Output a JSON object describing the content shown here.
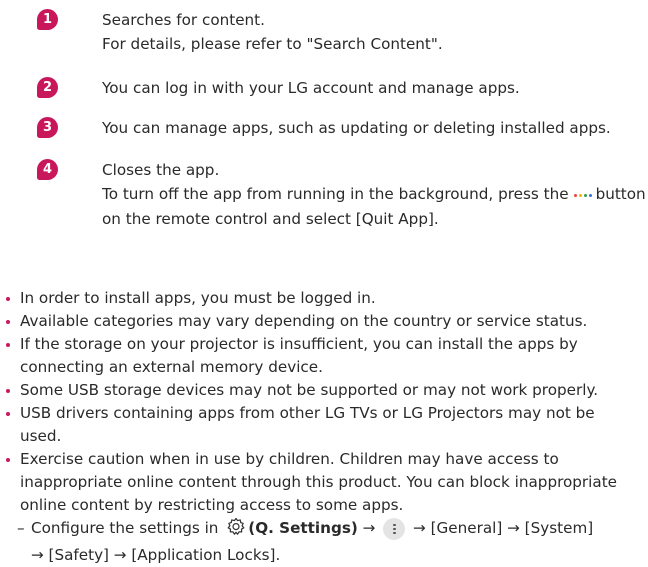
{
  "steps": [
    {
      "number": "1",
      "lines": [
        "Searches for content.",
        "For details, please refer to \"Search Content\"."
      ]
    },
    {
      "number": "2",
      "lines": [
        "You can log in with your LG account and manage apps."
      ]
    },
    {
      "number": "3",
      "lines": [
        "You can manage apps, such as updating or deleting installed apps."
      ]
    },
    {
      "number": "4",
      "line1": "Closes the app.",
      "line2_before": "To turn off the app from running in the background, press the",
      "line2_after": "button",
      "line3": "on the remote control and select [Quit App]."
    }
  ],
  "bullets": [
    [
      "In order to install apps, you must be logged in."
    ],
    [
      "Available categories may vary depending on the country or service status."
    ],
    [
      "If the storage on your projector is insufficient, you can install the apps by",
      "connecting an external memory device."
    ],
    [
      "Some USB storage devices may not be supported or may not work properly."
    ],
    [
      "USB drivers containing apps from other LG TVs or LG Projectors may not be",
      "used."
    ],
    [
      "Exercise caution when in use by children. Children may have access to",
      "inappropriate online content through this product. You can block inappropriate",
      "online content by restricting access to some apps."
    ]
  ],
  "sub_item": {
    "dash": "–",
    "before": "Configure the settings in",
    "settings_label": "(Q. Settings)",
    "arrow": "→",
    "after_more": "[General] → [System]",
    "line2": "→ [Safety] → [Application Locks]."
  },
  "colors": {
    "accent": "#c8175b",
    "text": "#2a2a2a",
    "button_bg": "#e4e4e4"
  },
  "icons": {
    "steps": "numbered-badge",
    "remote_button": "multicolor-dots-icon",
    "settings": "gear-icon",
    "more": "vertical-dots-icon"
  }
}
